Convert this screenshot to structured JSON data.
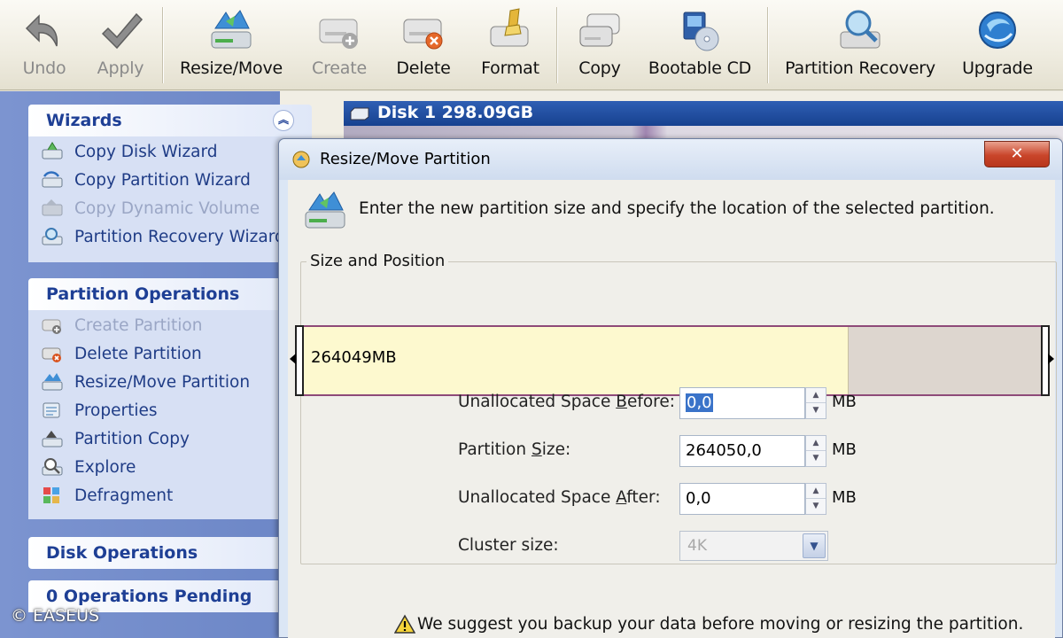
{
  "toolbar": {
    "undo": "Undo",
    "apply": "Apply",
    "resize_move": "Resize/Move",
    "create": "Create",
    "delete": "Delete",
    "format": "Format",
    "copy": "Copy",
    "bootable_cd": "Bootable CD",
    "partition_recovery": "Partition Recovery",
    "upgrade": "Upgrade"
  },
  "sidebar": {
    "wizards": {
      "title": "Wizards",
      "items": [
        "Copy Disk Wizard",
        "Copy Partition Wizard",
        "Copy Dynamic Volume",
        "Partition Recovery Wizard"
      ]
    },
    "partition_operations": {
      "title": "Partition Operations",
      "items": [
        "Create Partition",
        "Delete Partition",
        "Resize/Move Partition",
        "Properties",
        "Partition Copy",
        "Explore",
        "Defragment"
      ]
    },
    "disk_operations": {
      "title": "Disk Operations"
    },
    "pending": {
      "title": "0 Operations Pending"
    }
  },
  "disk": {
    "label": "Disk 1  298.09GB"
  },
  "dialog": {
    "title": "Resize/Move Partition",
    "close": "✕",
    "instruction": "Enter the new partition size and specify the location of the selected partition.",
    "group_label": "Size and Position",
    "partition_bar_label": "264049MB",
    "partition_fraction": 0.738,
    "fields": {
      "before_label_pre": "Unallocated Space ",
      "before_label_key": "B",
      "before_label_post": "efore:",
      "before_value": "0,0",
      "size_label_pre": "Partition ",
      "size_label_key": "S",
      "size_label_post": "ize:",
      "size_value": "264050,0",
      "after_label_pre": "Unallocated Space ",
      "after_label_key": "A",
      "after_label_post": "fter:",
      "after_value": "0,0",
      "unit": "MB",
      "cluster_label": "Cluster size:",
      "cluster_value": "4K"
    },
    "warning": "We suggest you backup your data before moving or resizing the partition."
  },
  "copyright": "© EASEUS",
  "colors": {
    "sidebar_bg": "#6d87c7",
    "disk_bar": "#17418f",
    "partition_used": "#fdf9cf",
    "partition_border": "#8e4a79"
  }
}
